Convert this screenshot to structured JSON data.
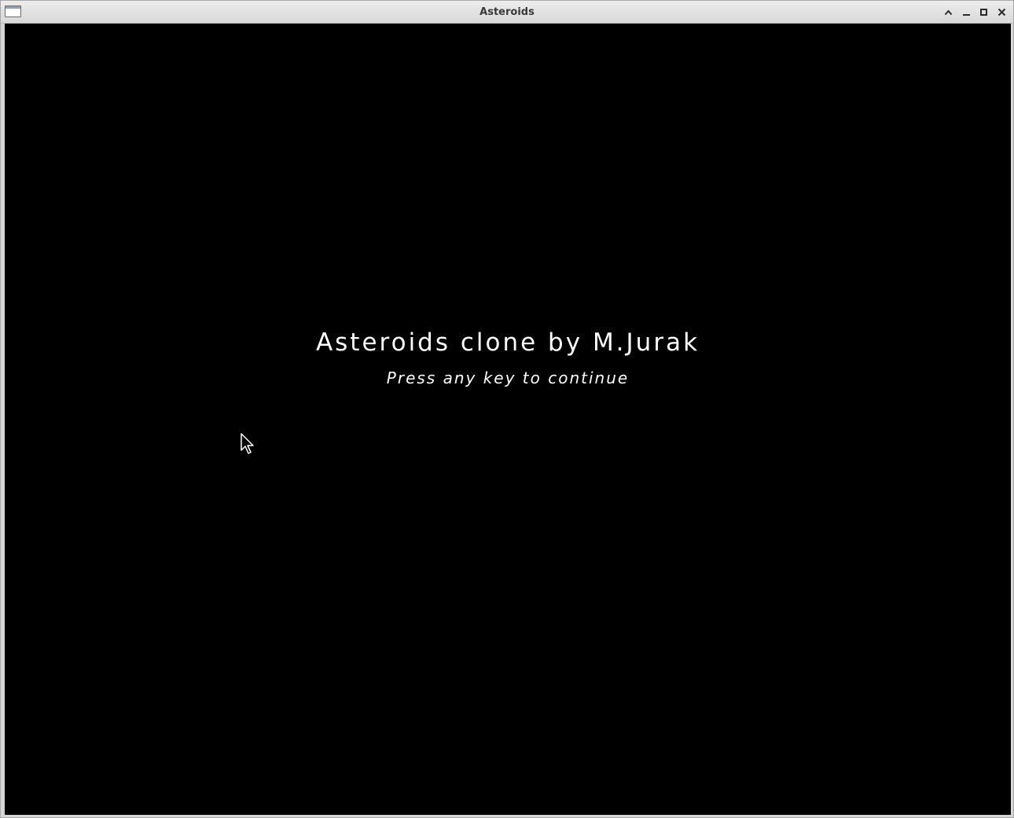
{
  "window": {
    "title": "Asteroids",
    "controls": {
      "shade_icon": "chevron-up-icon",
      "minimize_icon": "minimize-icon",
      "maximize_icon": "maximize-icon",
      "close_icon": "close-icon"
    }
  },
  "game": {
    "background_color": "#000000",
    "text_color": "#ffffff",
    "title_text": "Asteroids clone by M.Jurak",
    "prompt_text": "Press any key to continue"
  },
  "pointer": {
    "icon": "arrow-cursor-icon"
  }
}
